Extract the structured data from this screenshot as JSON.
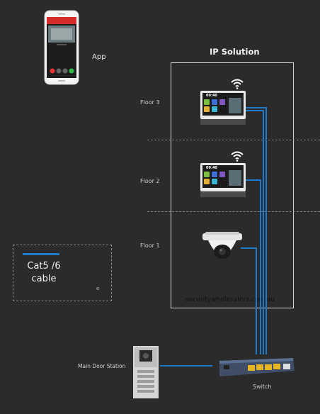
{
  "app": {
    "label": "App"
  },
  "solution": {
    "title": "IP Solution"
  },
  "floors": [
    {
      "label": "Floor 3",
      "device": "indoor-monitor",
      "wifi": true
    },
    {
      "label": "Floor 2",
      "device": "indoor-monitor",
      "wifi": true
    },
    {
      "label": "Floor 1",
      "device": "dome-camera",
      "wifi": false
    }
  ],
  "monitor_screen": {
    "time": "09:40"
  },
  "legend": {
    "text_line1": "Cat5 /6",
    "text_line2": "cable",
    "mark": "e"
  },
  "watermark": "securitywholesalers.com.au",
  "door_station": {
    "label": "Main Door Station"
  },
  "switch": {
    "label": "Switch"
  },
  "colors": {
    "background": "#2b2b2b",
    "cable": "#1f78c8",
    "box_border": "#d8d8d8",
    "phone_header": "#d62b2b"
  },
  "icons": [
    "wifi-icon",
    "phone-icon",
    "indoor-monitor-icon",
    "dome-camera-icon",
    "door-station-icon",
    "network-switch-icon"
  ]
}
